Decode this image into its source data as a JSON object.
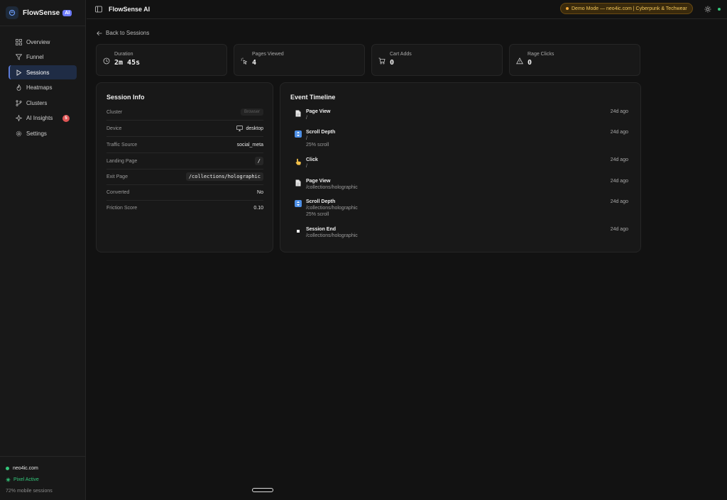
{
  "app": {
    "name": "FlowSense",
    "badge": "AI",
    "window_title": "FlowSense AI"
  },
  "sidebar": {
    "items": [
      {
        "label": "Overview"
      },
      {
        "label": "Funnel"
      },
      {
        "label": "Sessions"
      },
      {
        "label": "Heatmaps"
      },
      {
        "label": "Clusters"
      },
      {
        "label": "AI Insights",
        "badge": "5"
      },
      {
        "label": "Settings"
      }
    ],
    "footer": {
      "site": "neo4ic.com",
      "pixel_status": "Pixel Active",
      "mobile": "72% mobile sessions"
    }
  },
  "topbar": {
    "demo_label": "Demo Mode — neo4ic.com | Cyberpunk & Techwear"
  },
  "back_link": "Back to Sessions",
  "stats": [
    {
      "label": "Duration",
      "value": "2m 45s"
    },
    {
      "label": "Pages Viewed",
      "value": "4"
    },
    {
      "label": "Cart Adds",
      "value": "0"
    },
    {
      "label": "Rage Clicks",
      "value": "0"
    }
  ],
  "session_info": {
    "title": "Session Info",
    "rows": [
      {
        "key": "Cluster",
        "value": "Browser"
      },
      {
        "key": "Device",
        "value": "desktop"
      },
      {
        "key": "Traffic Source",
        "value": "social_meta"
      },
      {
        "key": "Landing Page",
        "value": "/"
      },
      {
        "key": "Exit Page",
        "value": "/collections/holographic"
      },
      {
        "key": "Converted",
        "value": "No"
      },
      {
        "key": "Friction Score",
        "value": "0.10"
      }
    ]
  },
  "timeline": {
    "title": "Event Timeline",
    "events": [
      {
        "icon": "page-icon",
        "title": "Page View",
        "path": "/",
        "detail": "",
        "time": "24d ago"
      },
      {
        "icon": "scroll-icon",
        "title": "Scroll Depth",
        "path": "/",
        "detail": "25% scroll",
        "time": "24d ago"
      },
      {
        "icon": "click-icon",
        "title": "Click",
        "path": "/",
        "detail": "",
        "time": "24d ago"
      },
      {
        "icon": "page-icon",
        "title": "Page View",
        "path": "/collections/holographic",
        "detail": "",
        "time": "24d ago"
      },
      {
        "icon": "scroll-icon",
        "title": "Scroll Depth",
        "path": "/collections/holographic",
        "detail": "25% scroll",
        "time": "24d ago"
      },
      {
        "icon": "stop-icon",
        "title": "Session End",
        "path": "/collections/holographic",
        "detail": "",
        "time": "24d ago"
      }
    ]
  },
  "colors": {
    "accent": "#5b7bd6",
    "active_bg": "#1f2c45",
    "demo_bg": "#3a2a0c",
    "demo_text": "#f3c75a",
    "status_green": "#34c77b",
    "badge_red": "#e05555"
  }
}
